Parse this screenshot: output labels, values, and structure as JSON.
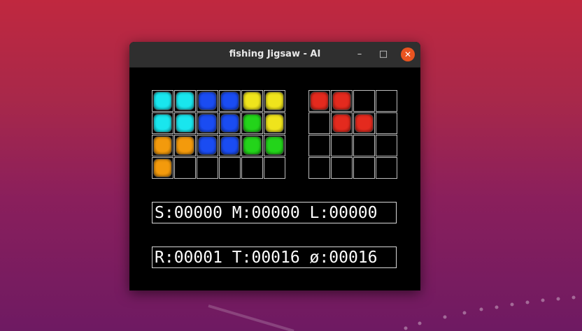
{
  "window": {
    "title": "fishing Jigsaw - AI",
    "minimize_glyph": "–",
    "maximize_glyph": "□",
    "close_glyph": "✕"
  },
  "colors": {
    "cyan": "#19e6ee",
    "blue": "#1a4cf2",
    "yellow": "#efe41c",
    "green": "#23d41a",
    "orange": "#f39a0c",
    "red": "#e42a1e",
    "empty": "#000000",
    "grid_line": "#bdbdbd",
    "close_button": "#e95420"
  },
  "main_board": {
    "columns": 6,
    "rows": 4,
    "cells": [
      [
        "cyan",
        "cyan",
        "blue",
        "blue",
        "yellow",
        "yellow"
      ],
      [
        "cyan",
        "cyan",
        "blue",
        "blue",
        "green",
        "yellow"
      ],
      [
        "orange",
        "orange",
        "blue",
        "blue",
        "green",
        "green"
      ],
      [
        "orange",
        "empty",
        "empty",
        "empty",
        "empty",
        "empty"
      ]
    ]
  },
  "next_board": {
    "columns": 4,
    "rows": 4,
    "cells": [
      [
        "red",
        "red",
        "empty",
        "empty"
      ],
      [
        "empty",
        "red",
        "red",
        "empty"
      ],
      [
        "empty",
        "empty",
        "empty",
        "empty"
      ],
      [
        "empty",
        "empty",
        "empty",
        "empty"
      ]
    ]
  },
  "stats": {
    "line1": "S:00000 M:00000 L:00000",
    "line2": "R:00001 T:00016 ø:00016"
  }
}
